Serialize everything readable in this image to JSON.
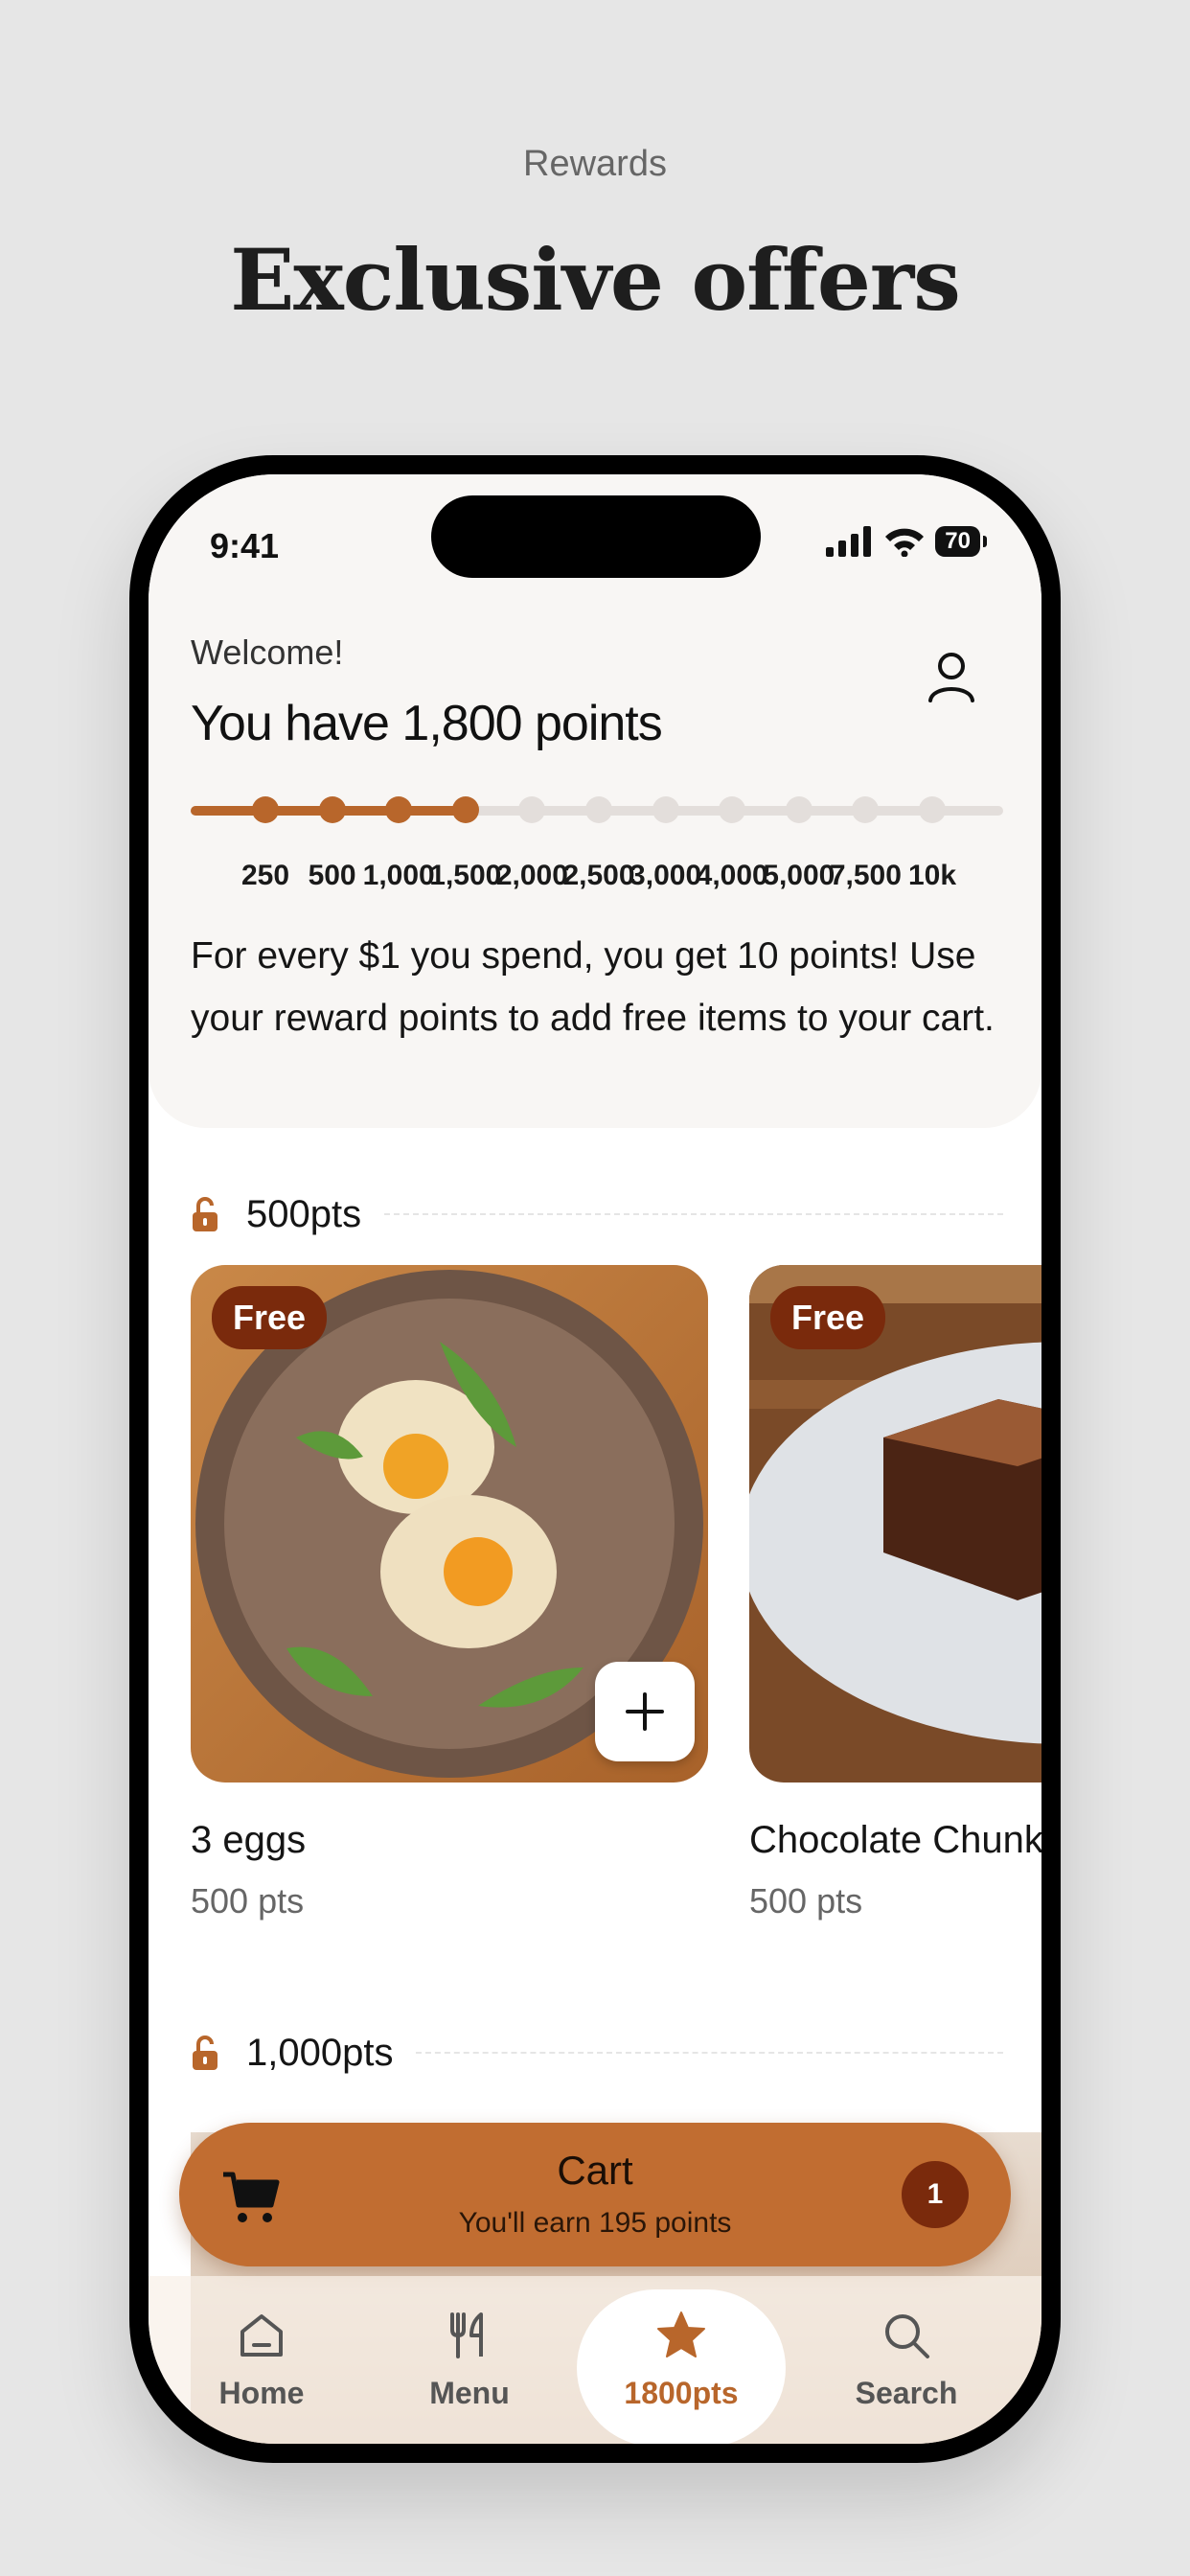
{
  "page": {
    "subtitle": "Rewards",
    "title": "Exclusive offers"
  },
  "status": {
    "time": "9:41",
    "battery": "70"
  },
  "header": {
    "welcome": "Welcome!",
    "points_title": "You have 1,800 points",
    "profile_icon": "user-icon"
  },
  "progress": {
    "current_points": 1800,
    "fill_fraction": 0.34,
    "levels": [
      "250",
      "500",
      "1,000",
      "1,500",
      "2,000",
      "2,500",
      "3,000",
      "4,000",
      "5,000",
      "7,500",
      "10k"
    ],
    "reached_count": 4
  },
  "description": "For every $1 you spend, you get 10 points! Use your reward points to add free items to your cart.",
  "sections": [
    {
      "label": "500pts",
      "icon": "unlock-icon"
    },
    {
      "label": "1,000pts",
      "icon": "unlock-icon"
    }
  ],
  "items": [
    {
      "badge": "Free",
      "name": "3 eggs",
      "points": "500 pts"
    },
    {
      "badge": "Free",
      "name": "Chocolate Chunk Brownie",
      "points": "500 pts"
    }
  ],
  "cart": {
    "title": "Cart",
    "subtitle": "You'll earn 195 points",
    "count": "1",
    "icon": "cart-icon"
  },
  "tabs": [
    {
      "label": "Home",
      "icon": "home-icon"
    },
    {
      "label": "Menu",
      "icon": "utensils-icon"
    },
    {
      "label": "1800pts",
      "icon": "star-icon",
      "active": true
    },
    {
      "label": "Search",
      "icon": "search-icon"
    }
  ],
  "colors": {
    "accent": "#b8662b",
    "badge": "#7a2a0c",
    "cart": "#c16d31"
  }
}
